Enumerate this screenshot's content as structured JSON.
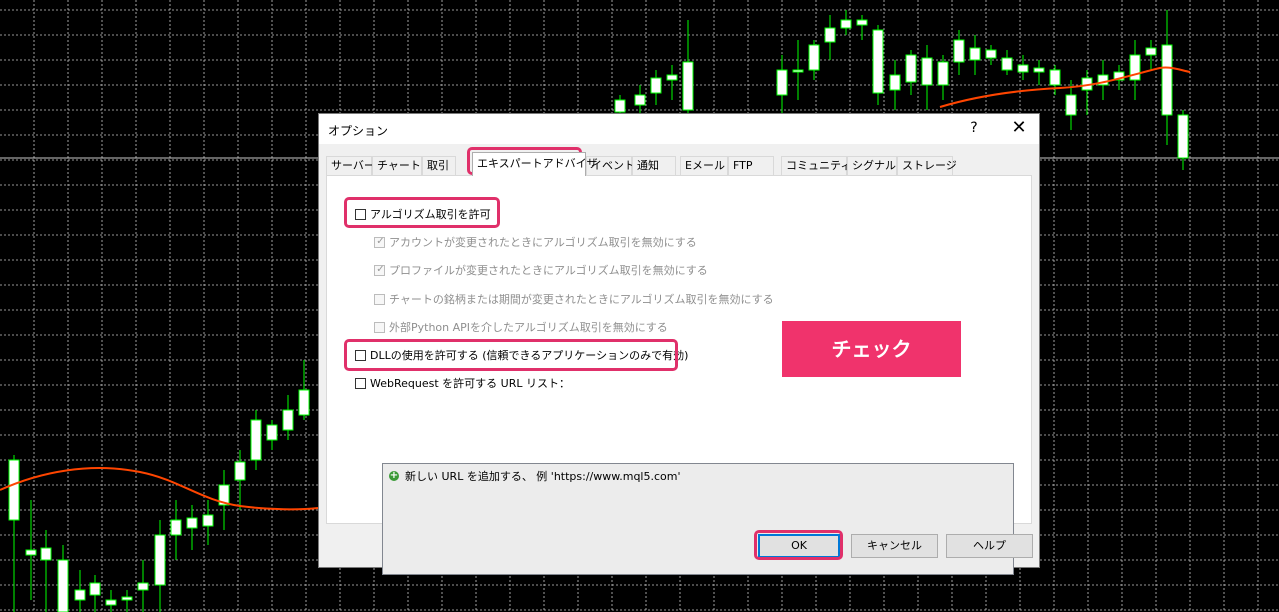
{
  "dialog": {
    "title": "オプション",
    "help_label": "?",
    "close_label": "✕"
  },
  "tabs": [
    {
      "label": "サーバー"
    },
    {
      "label": "チャート"
    },
    {
      "label": "取引"
    },
    {
      "label": "エキスパートアドバイザ"
    },
    {
      "label": "イベント"
    },
    {
      "label": "通知"
    },
    {
      "label": "Eメール"
    },
    {
      "label": "FTP"
    },
    {
      "label": "コミュニティー"
    },
    {
      "label": "シグナル"
    },
    {
      "label": "ストレージ"
    }
  ],
  "expert": {
    "algo_trading": {
      "label": "アルゴリズム取引を許可",
      "checked": false
    },
    "sub_options": [
      {
        "label": "アカウントが変更されたときにアルゴリズム取引を無効にする",
        "checked": true
      },
      {
        "label": "プロファイルが変更されたときにアルゴリズム取引を無効にする",
        "checked": true
      },
      {
        "label": "チャートの銘柄または期間が変更されたときにアルゴリズム取引を無効にする",
        "checked": false
      },
      {
        "label": "外部Python APIを介したアルゴリズム取引を無効にする",
        "checked": false
      }
    ],
    "dll": {
      "label": "DLLの使用を許可する (信頼できるアプリケーションのみで有効)",
      "checked": false
    },
    "webrequest": {
      "label": "WebRequest を許可する URL リスト：",
      "checked": false
    },
    "url_list_add": "新しい URL を追加する、 例 'https://www.mql5.com'"
  },
  "annotation": {
    "label": "チェック",
    "color": "#f0336c"
  },
  "buttons": {
    "ok": "OK",
    "cancel": "キャンセル",
    "help": "ヘルプ"
  },
  "chart_colors": {
    "background": "#000000",
    "grid": "#c8c8c8",
    "candle": "#00ff00",
    "bull_body": "#ffffff",
    "ma_line": "#ff4500"
  }
}
